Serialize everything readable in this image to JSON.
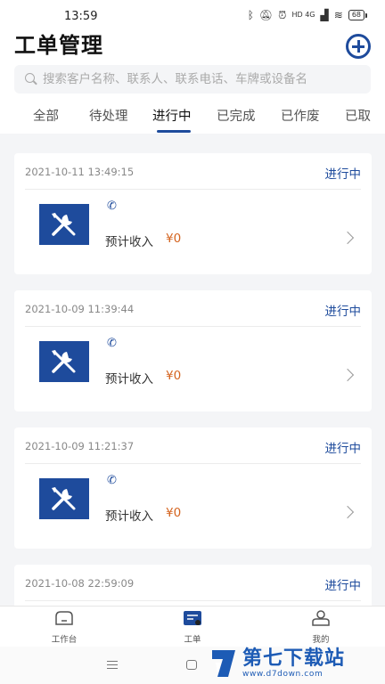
{
  "status_bar": {
    "time": "13:59",
    "signal": "HD 4G",
    "battery": "68"
  },
  "header": {
    "title": "工单管理",
    "search_placeholder": "搜索客户名称、联系人、联系电话、车牌或设备名"
  },
  "tabs": [
    {
      "label": "全部"
    },
    {
      "label": "待处理"
    },
    {
      "label": "进行中",
      "active": true
    },
    {
      "label": "已完成"
    },
    {
      "label": "已作废"
    },
    {
      "label": "已取"
    }
  ],
  "orders": [
    {
      "time": "2021-10-11 13:49:15",
      "status": "进行中",
      "income_label": "预计收入",
      "income_value": "¥0"
    },
    {
      "time": "2021-10-09 11:39:44",
      "status": "进行中",
      "income_label": "预计收入",
      "income_value": "¥0"
    },
    {
      "time": "2021-10-09 11:21:37",
      "status": "进行中",
      "income_label": "预计收入",
      "income_value": "¥0"
    },
    {
      "time": "2021-10-08 22:59:09",
      "status": "进行中"
    }
  ],
  "bottom_nav": [
    {
      "label": "工作台",
      "icon": "workbench-icon"
    },
    {
      "label": "工单",
      "icon": "work-order-icon",
      "active": true
    },
    {
      "label": "我的",
      "icon": "profile-icon"
    }
  ],
  "watermark": {
    "title": "第七下载站",
    "url": "www.d7down.com"
  },
  "colors": {
    "accent": "#1e4b9c",
    "income": "#d4631e"
  }
}
